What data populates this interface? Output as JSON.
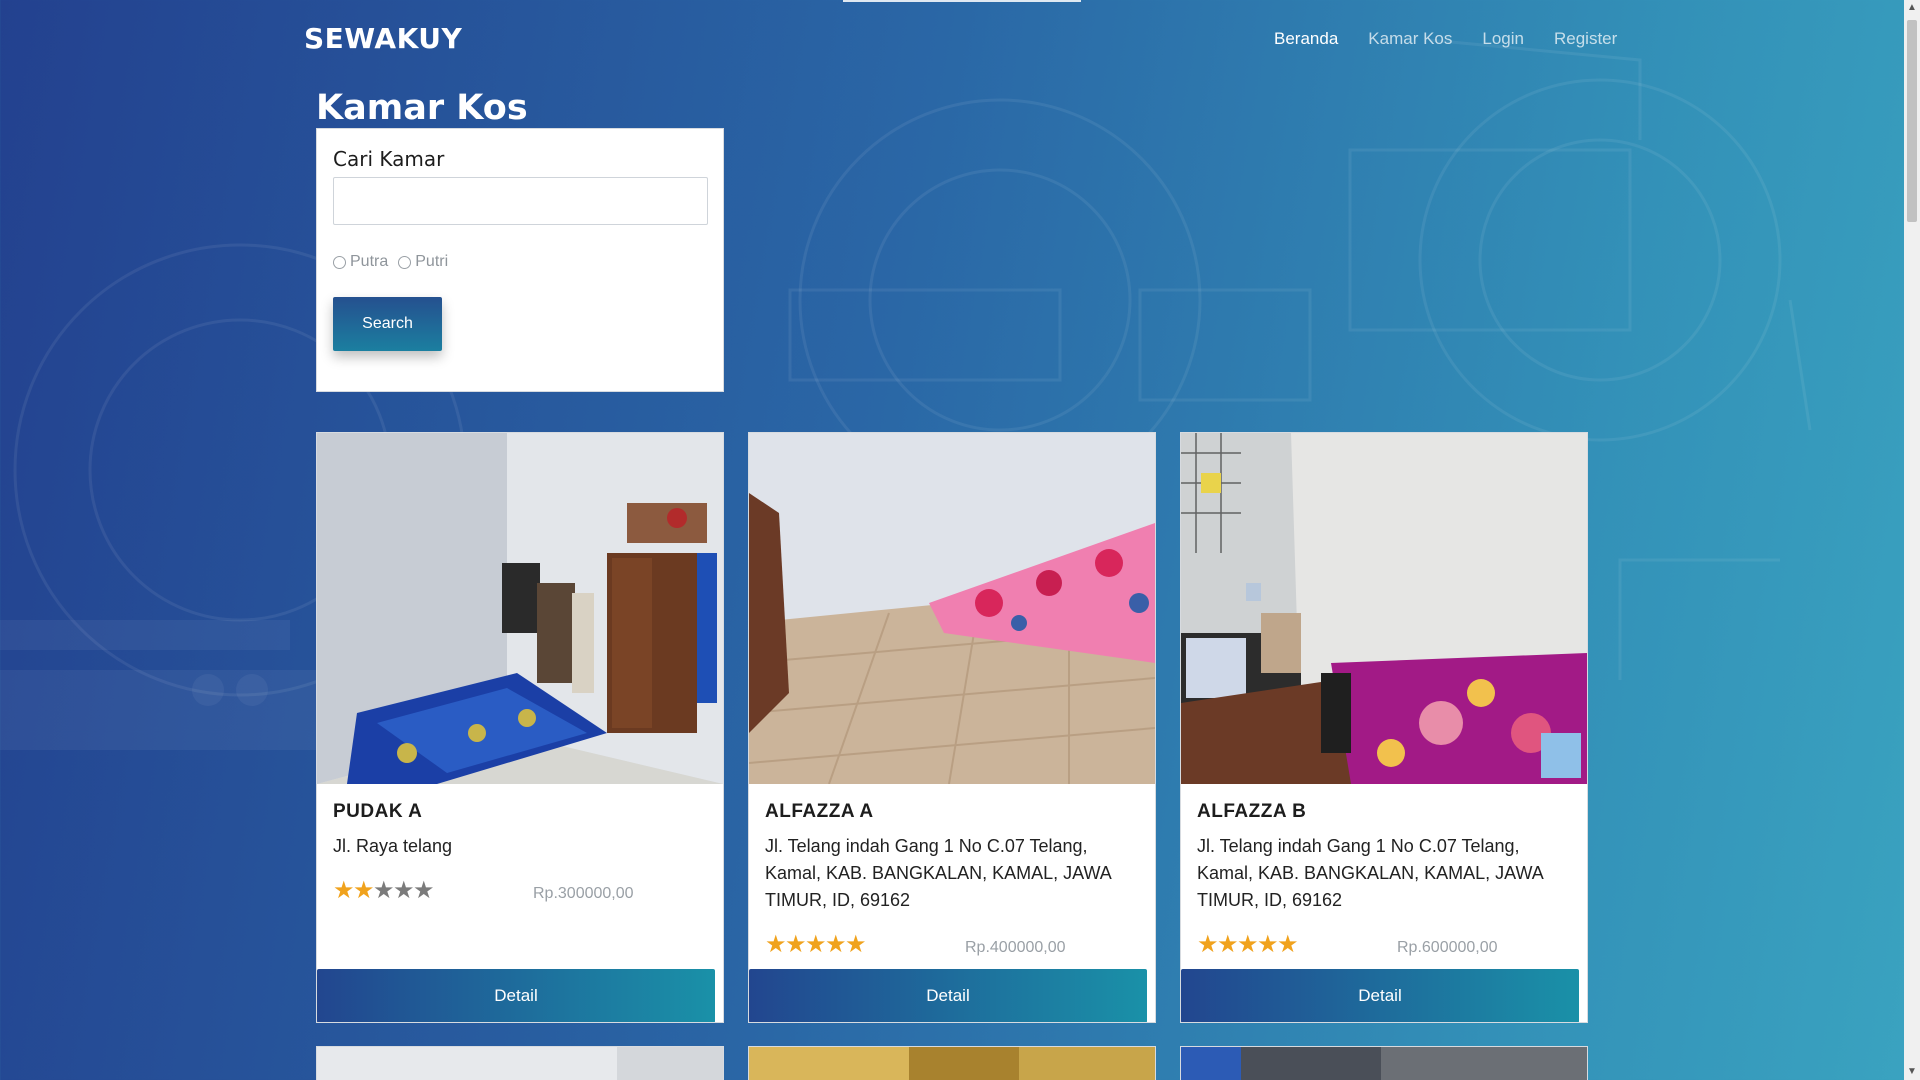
{
  "navbar": {
    "brand": "SEWAKUY",
    "links": [
      {
        "label": "Beranda",
        "active": true
      },
      {
        "label": "Kamar Kos",
        "active": false
      },
      {
        "label": "Login",
        "active": false
      },
      {
        "label": "Register",
        "active": false
      }
    ]
  },
  "page_title": "Kamar Kos",
  "search": {
    "title": "Cari Kamar",
    "input_value": "",
    "input_placeholder": "",
    "radio_options": [
      "Putra",
      "Putri"
    ],
    "button_label": "Search"
  },
  "cards": [
    {
      "name": "PUDAK A",
      "address": "Jl. Raya telang",
      "rating": 2,
      "rating_max": 5,
      "price": "Rp.300000,00",
      "detail_label": "Detail"
    },
    {
      "name": "ALFAZZA A",
      "address": "Jl. Telang indah Gang 1 No C.07 Telang, Kamal, KAB. BANGKALAN, KAMAL, JAWA TIMUR, ID, 69162",
      "rating": 5,
      "rating_max": 5,
      "price": "Rp.400000,00",
      "detail_label": "Detail"
    },
    {
      "name": "ALFAZZA B",
      "address": "Jl. Telang indah Gang 1 No C.07 Telang, Kamal, KAB. BANGKALAN, KAMAL, JAWA TIMUR, ID, 69162",
      "rating": 5,
      "rating_max": 5,
      "price": "Rp.600000,00",
      "detail_label": "Detail"
    }
  ],
  "colors": {
    "accent_star": "#f0a21d",
    "button_start": "#22468f",
    "button_end": "#1a91a8"
  },
  "icons": {
    "star_filled": "star-icon",
    "star_empty": "star-outline-icon",
    "radio": "radio-button-icon"
  }
}
